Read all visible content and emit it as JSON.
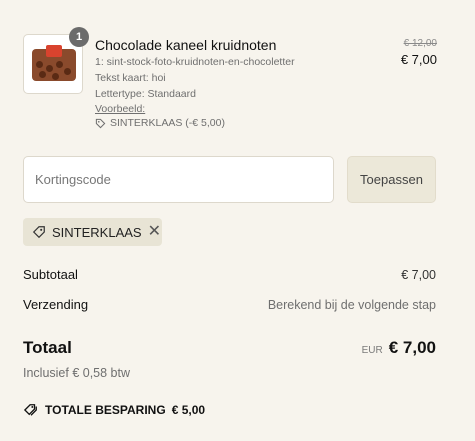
{
  "product": {
    "quantity": "1",
    "title": "Chocolade kaneel kruidnoten",
    "variant": "1: sint-stock-foto-kruidnoten-en-chocoletter",
    "card_text": "Tekst kaart: hoi",
    "font": "Lettertype: Standaard",
    "preview_link": "Voorbeeld:",
    "discount": "SINTERKLAAS (-€ 5,00)",
    "price_old": "€ 12,00",
    "price_new": "€ 7,00",
    "image_icon": "product-image-icon"
  },
  "discount_form": {
    "placeholder": "Kortingscode",
    "value": "",
    "apply_label": "Toepassen"
  },
  "applied_code": {
    "code": "SINTERKLAAS",
    "tag_icon": "tag-icon",
    "remove_icon": "close-icon",
    "remove_glyph": "✕"
  },
  "summary": {
    "subtotal_label": "Subtotaal",
    "subtotal_value": "€ 7,00",
    "shipping_label": "Verzending",
    "shipping_value": "Berekend bij de volgende stap",
    "total_label": "Totaal",
    "currency": "EUR",
    "total_value": "€ 7,00",
    "vat_note": "Inclusief € 0,58 btw",
    "savings_label": "TOTALE BESPARING",
    "savings_value": "€ 5,00",
    "savings_icon": "tags-icon"
  },
  "colors": {
    "background": "#f7f4ed",
    "button_bg": "#ece8d9",
    "chip_bg": "#e8e4d5",
    "badge": "#6b6b6b"
  }
}
